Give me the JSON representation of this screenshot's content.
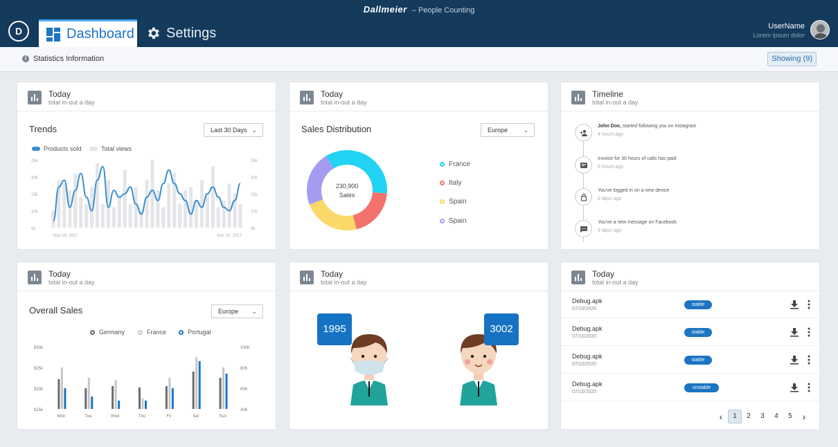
{
  "header": {
    "brand": "Dallmeier",
    "brand_suffix": "– People Counting",
    "logo_letter": "D",
    "tabs": [
      {
        "label": "Dashboard",
        "active": true,
        "icon": "dashboard-grid-icon"
      },
      {
        "label": "Settings",
        "active": false,
        "icon": "gear-icon"
      }
    ],
    "user": {
      "name": "UserName",
      "subtitle": "Lorem ipsum dolor"
    }
  },
  "infobar": {
    "label": "Statistics Information",
    "showing": "Showing (9)"
  },
  "colors": {
    "header_bg": "#143a5c",
    "accent": "#1d74c4",
    "badge_blue": "#1c74c2",
    "pie": [
      "#22d3f3",
      "#f4726b",
      "#fbd86a",
      "#a59cf2"
    ]
  },
  "cards": {
    "trends": {
      "title": "Today",
      "subtitle": "total in-out a day",
      "section": "Trends",
      "select": "Last 30 Days",
      "legend": [
        "Products sold",
        "Total views"
      ]
    },
    "sales_distribution": {
      "title": "Today",
      "subtitle": "total in-out a day",
      "section": "Sales Distribution",
      "select": "Europe",
      "center_value": "230,900",
      "center_label": "Sales",
      "legend": [
        "France",
        "Italy",
        "Spain",
        "Spain"
      ]
    },
    "timeline": {
      "title": "Timeline",
      "subtitle": "total in-out a day",
      "items": [
        {
          "actor": "John Doe,",
          "text": "started following you on Instagram",
          "time": "4 hours ago",
          "icon": "person-add-icon"
        },
        {
          "actor": "",
          "text": "Invoice for 30 hours of calls has paid",
          "time": "6 hours ago",
          "icon": "receipt-icon"
        },
        {
          "actor": "",
          "text": "You've logged in on a new device",
          "time": "2 days ago",
          "icon": "lock-icon"
        },
        {
          "actor": "",
          "text": "You've a new message on Facebook",
          "time": "3 days ago",
          "icon": "message-icon"
        }
      ]
    },
    "overall_sales": {
      "title": "Today",
      "subtitle": "total in-out a day",
      "section": "Overall Sales",
      "select": "Europe",
      "legend": [
        "Germany",
        "France",
        "Portugal"
      ]
    },
    "counting": {
      "title": "Today",
      "subtitle": "total in-out a day",
      "counts": [
        "1995",
        "3002"
      ]
    },
    "files": {
      "title": "Today",
      "subtitle": "total in-out a day",
      "rows": [
        {
          "name": "Debug.apk",
          "date": "07/10/2020",
          "status": "stable"
        },
        {
          "name": "Debug.apk",
          "date": "07/10/2020",
          "status": "stable"
        },
        {
          "name": "Debug.apk",
          "date": "07/10/2020",
          "status": "stable"
        },
        {
          "name": "Debug.apk",
          "date": "07/10/2020",
          "status": "unstable"
        }
      ],
      "pages": [
        "1",
        "2",
        "3",
        "4",
        "5"
      ],
      "current_page": "1"
    }
  },
  "chart_data": [
    {
      "type": "line",
      "title": "Trends",
      "x_start_label": "Nov 10, 2017",
      "x_end_label": "Dec 10, 2017",
      "y_ticks": [
        "25k",
        "20k",
        "15k",
        "10k",
        "5k"
      ],
      "y2_ticks": [
        "25k",
        "20k",
        "15k",
        "10k",
        "5k"
      ],
      "ylim": [
        5,
        25
      ],
      "series": [
        {
          "name": "Products sold",
          "color": "#3b8ed0",
          "values": [
            7,
            17,
            19,
            11,
            16,
            21,
            14,
            10,
            19,
            23,
            11,
            16,
            14,
            15,
            17,
            12,
            9,
            14,
            16,
            13,
            18,
            22,
            18,
            15,
            13,
            9,
            13,
            11,
            15,
            17,
            14,
            11,
            10,
            13,
            18
          ]
        },
        {
          "name": "Total views",
          "color": "#e3e5e8",
          "values": [
            10,
            19,
            18,
            16,
            21,
            14,
            12,
            17,
            24,
            12,
            19,
            11,
            14,
            22,
            12,
            17,
            10,
            19,
            25,
            16,
            11,
            18,
            21,
            12,
            16,
            17,
            13,
            19,
            15,
            23,
            11,
            13,
            18,
            15,
            12
          ]
        }
      ]
    },
    {
      "type": "pie",
      "title": "Sales Distribution",
      "center_value": "230,900",
      "slices": [
        {
          "label": "France",
          "value": 35,
          "color": "#22d3f3"
        },
        {
          "label": "Italy",
          "value": 20,
          "color": "#f4726b"
        },
        {
          "label": "Spain",
          "value": 23,
          "color": "#fbd86a"
        },
        {
          "label": "Spain",
          "value": 22,
          "color": "#a59cf2"
        }
      ]
    },
    {
      "type": "bar",
      "title": "Overall Sales",
      "categories": [
        "Mon",
        "Tue",
        "Wed",
        "Thu",
        "Fri",
        "Sat",
        "Sun"
      ],
      "y_ticks": [
        "$30k",
        "$25k",
        "$20k",
        "$15k"
      ],
      "y2_ticks": [
        "100K",
        "80K",
        "60K",
        "40K"
      ],
      "ylim": [
        15,
        30
      ],
      "series": [
        {
          "name": "Germany",
          "color": "#6b6b6b",
          "values": [
            22.2,
            20,
            20.5,
            20.2,
            20.5,
            24,
            22.5
          ]
        },
        {
          "name": "France",
          "color": "#c4c6c9",
          "values": [
            25,
            22.5,
            22,
            17.5,
            22.5,
            27.5,
            25
          ]
        },
        {
          "name": "Portugal",
          "color": "#1c74c2",
          "values": [
            20,
            18,
            17,
            17,
            20,
            26.5,
            23.5
          ]
        }
      ]
    }
  ]
}
